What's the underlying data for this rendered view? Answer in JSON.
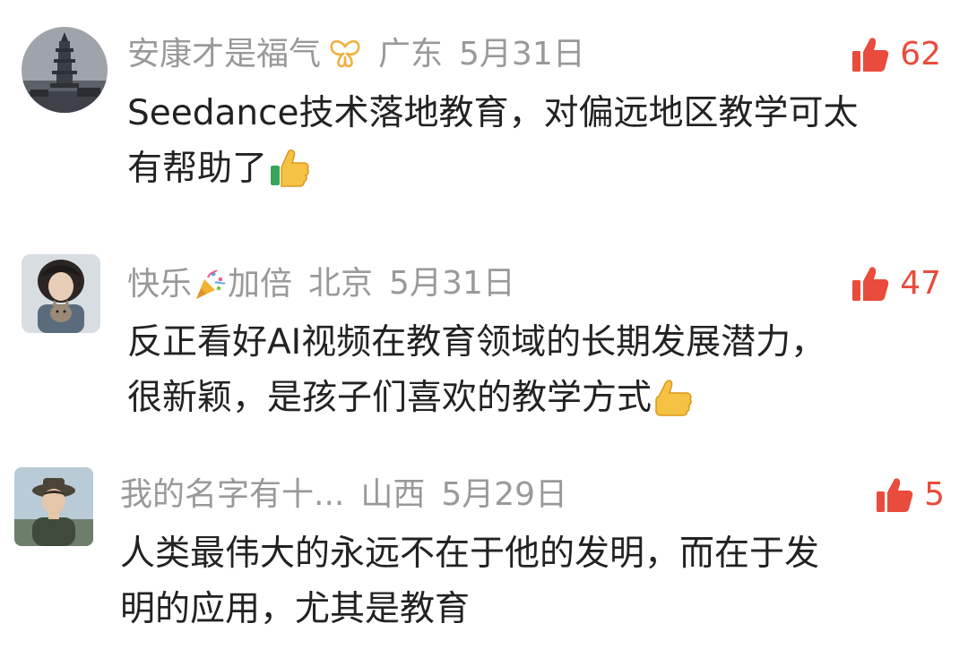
{
  "comments": [
    {
      "username": "安康才是福气",
      "location": "广东",
      "date": "5月31日",
      "likes": "62",
      "text_line1": "Seedance技术落地教育，对偏远地区教学可太",
      "text_line2": "有帮助了",
      "avatar_icon": "pagoda-avatar",
      "badge_icon": "butterfly-badge-icon",
      "trailing_emoji": "thumbs-up-emoji"
    },
    {
      "username_part1": "快乐",
      "username_part2": "加倍",
      "location": "北京",
      "date": "5月31日",
      "likes": "47",
      "text_line1": "反正看好AI视频在教育领域的长期发展潜力，",
      "text_line2": "很新颖，是孩子们喜欢的教学方式",
      "avatar_icon": "person-with-cat-avatar",
      "username_emoji": "party-popper-emoji",
      "trailing_emoji": "thumbs-up-emoji"
    },
    {
      "username": "我的名字有十...",
      "location": "山西",
      "date": "5月29日",
      "likes": "5",
      "text_line1": "人类最伟大的永远不在于他的发明，而在于发",
      "text_line2": "明的应用，尤其是教育",
      "avatar_icon": "anime-character-avatar"
    }
  ],
  "colors": {
    "meta_text": "#999999",
    "like_accent": "#e94b3c",
    "body_text": "#222222",
    "badge": "#f0b040"
  }
}
